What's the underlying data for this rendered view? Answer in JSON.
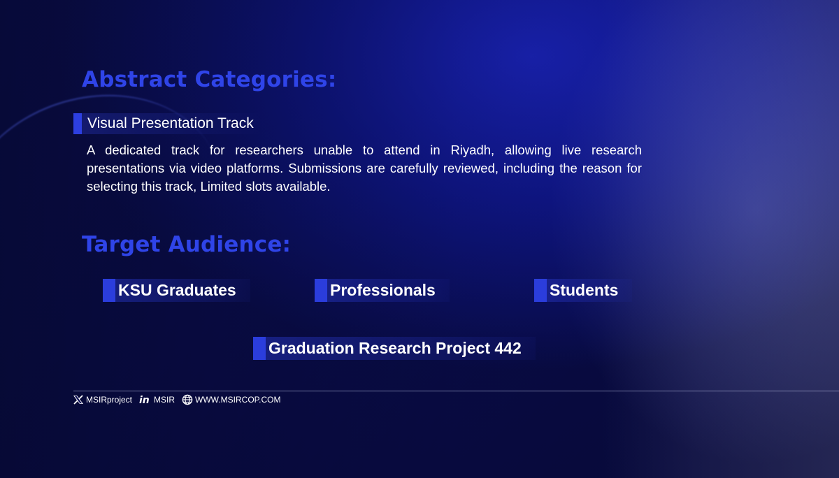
{
  "abstract": {
    "heading": "Abstract Categories:",
    "track_title": "Visual Presentation Track",
    "description": "A dedicated track for researchers unable to attend in Riyadh, allowing live research presentations via video platforms. Submissions are carefully reviewed, including the reason for selecting this track, Limited slots available."
  },
  "audience": {
    "heading": "Target Audience:",
    "items": [
      "KSU Graduates",
      "Professionals",
      "Students",
      "Graduation Research Project 442"
    ]
  },
  "footer": {
    "x_handle": "MSIRproject",
    "in_handle": "MSIR",
    "website": "WWW.MSIRCOP.COM",
    "icons": [
      "x-logo-icon",
      "linkedin-icon",
      "globe-icon"
    ]
  },
  "colors": {
    "accent": "#2f44e8",
    "background": "#0b0f5a"
  }
}
